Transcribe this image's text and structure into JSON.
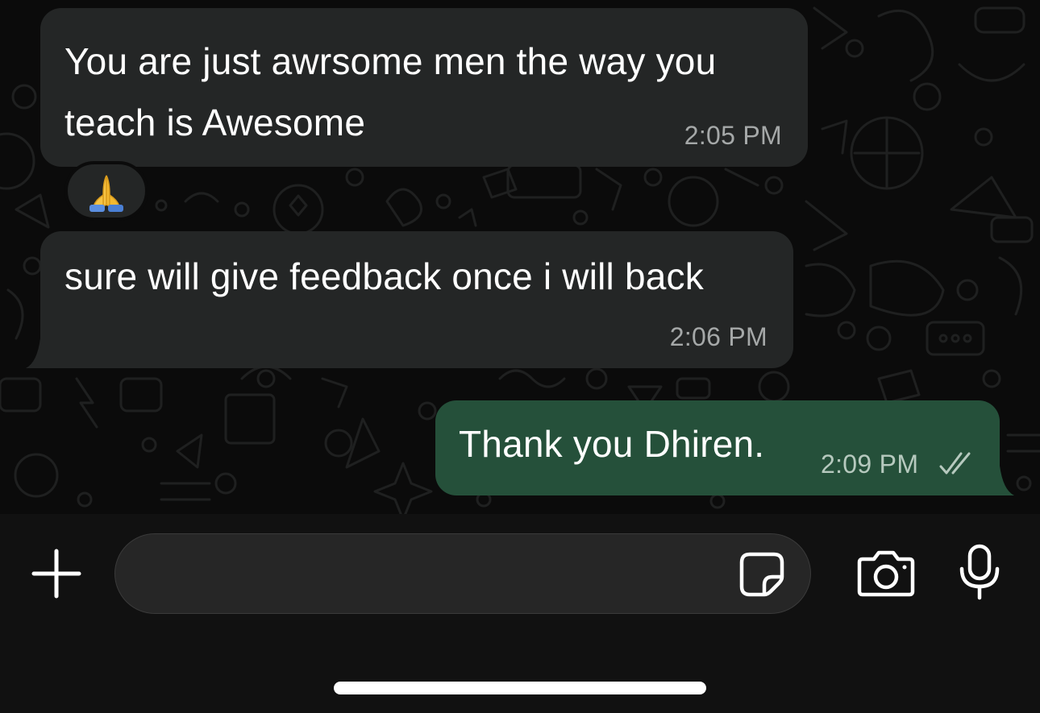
{
  "messages": [
    {
      "direction": "incoming",
      "text": "You are just awrsome men the way you\nteach is Awesome",
      "time": "2:05 PM",
      "reaction": "🙏"
    },
    {
      "direction": "incoming",
      "text": "sure will give feedback once i will back",
      "time": "2:06 PM"
    },
    {
      "direction": "outgoing",
      "text": "Thank you Dhiren.",
      "time": "2:09 PM",
      "status_icon": "double-check-icon"
    }
  ],
  "composer": {
    "value": "",
    "placeholder": "",
    "icons": {
      "attach": "plus-icon",
      "sticker": "sticker-icon",
      "camera": "camera-icon",
      "mic": "microphone-icon"
    }
  },
  "colors": {
    "background": "#0b0b0b",
    "incoming_bubble": "#242626",
    "outgoing_bubble": "#25503a",
    "timestamp": "#a5a8a8"
  }
}
